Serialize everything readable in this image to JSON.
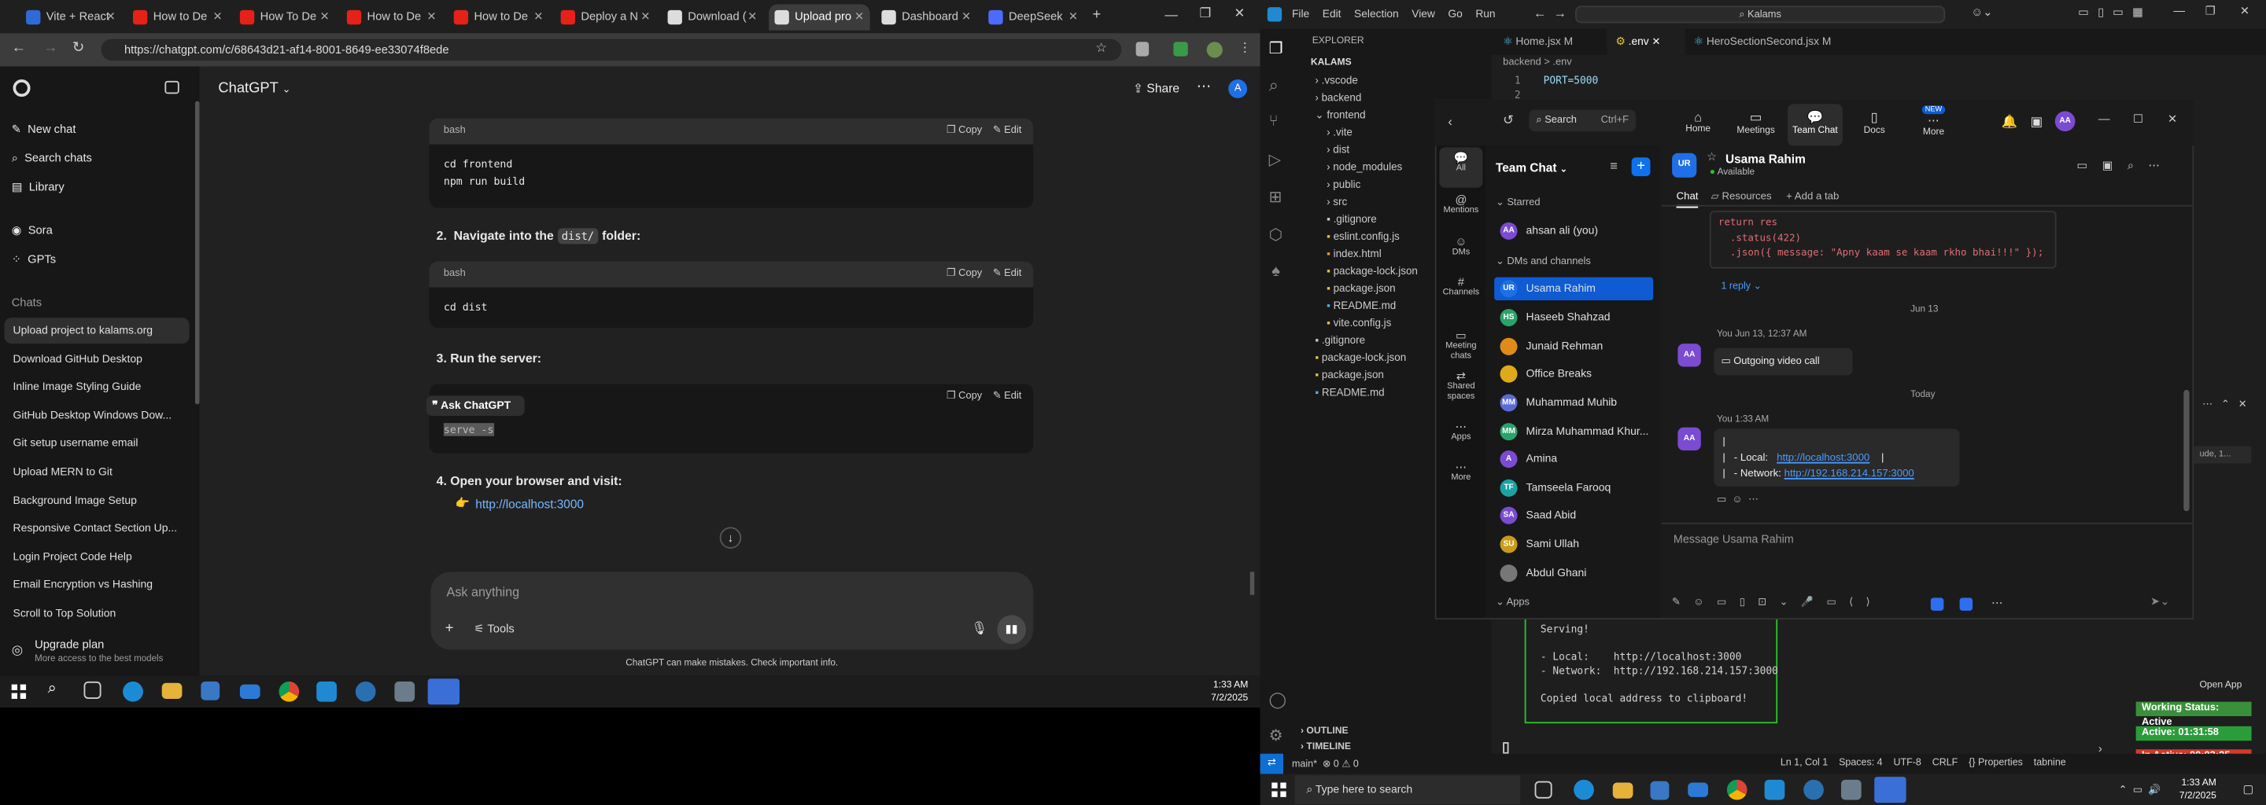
{
  "chrome": {
    "tabs": [
      "Vite + React",
      "How to De",
      "How To De",
      "How to De",
      "How to De",
      "Deploy a N",
      "Download (",
      "Upload pro",
      "Dashboard",
      "DeepSeek"
    ],
    "url": "https://chatgpt.com/c/68643d21-af14-8001-8649-ee33074f8ede",
    "model": "ChatGPT",
    "share": "Share",
    "avatar": "A"
  },
  "gpt_sidebar": {
    "new_chat": "New chat",
    "search_chats": "Search chats",
    "library": "Library",
    "sora": "Sora",
    "gpts": "GPTs",
    "chats_heading": "Chats",
    "chats": [
      "Upload project to kalams.org",
      "Download GitHub Desktop",
      "Inline Image Styling Guide",
      "GitHub Desktop Windows Dow...",
      "Git setup username email",
      "Upload MERN to Git",
      "Background Image Setup",
      "Responsive Contact Section Up...",
      "Login Project Code Help",
      "Email Encryption vs Hashing",
      "Scroll to Top Solution"
    ],
    "upgrade_title": "Upgrade plan",
    "upgrade_sub": "More access to the best models"
  },
  "conversation": {
    "lang": "bash",
    "copy": "Copy",
    "edit": "Edit",
    "code1": "cd frontend\nnpm run build",
    "step2_num": "2.",
    "step2_a": "Navigate into the",
    "step2_code": "dist/",
    "step2_b": "folder:",
    "code2": "cd dist",
    "step3": "3.  Run the server:",
    "ask_chatgpt": "Ask ChatGPT",
    "code3": "serve -s",
    "step4": "4.  Open your browser and visit:",
    "link": "http://localhost:3000",
    "composer_placeholder": "Ask anything",
    "tools": "Tools",
    "disclaimer": "ChatGPT can make mistakes. Check important info."
  },
  "taskbar_left": {
    "time": "1:33 AM",
    "date": "7/2/2025"
  },
  "vscode": {
    "menu": [
      "File",
      "Edit",
      "Selection",
      "View",
      "Go",
      "Run"
    ],
    "search": "Kalams",
    "explorer_title": "EXPLORER",
    "root": "KALAMS",
    "tree": [
      ".vscode",
      "backend",
      "frontend",
      ".vite",
      "dist",
      "node_modules",
      "public",
      "src",
      ".gitignore",
      "eslint.config.js",
      "index.html",
      "package-lock.json",
      "package.json",
      "README.md",
      "vite.config.js",
      ".gitignore",
      "package-lock.json",
      "package.json",
      "README.md"
    ],
    "tabs": [
      "Home.jsx  M",
      ".env",
      "HeroSectionSecond.jsx  M"
    ],
    "breadcrumb": "backend > .env",
    "line1_no": "1",
    "line1": "PORT=5000",
    "line2_no": "2",
    "terminal": "Serving!\n\n- Local:    http://localhost:3000\n- Network:  http://192.168.214.157:3000\n\nCopied local address to clipboard!",
    "outline": "OUTLINE",
    "timeline": "TIMELINE",
    "status_left": "main*  ⊗ 0 ⚠ 0",
    "status_right": "Ln 1, Col 1    Spaces: 4    UTF-8    CRLF    {} Properties    tabnine",
    "open_app": "Open App",
    "working_status": "Working Status: Active",
    "active": "Active: 01:31:58",
    "in_active": "In Active: 00:03:25"
  },
  "taskbar_right": {
    "search": "Type here to search",
    "time": "1:33 AM",
    "date": "7/2/2025"
  },
  "zoom": {
    "search": "Search",
    "shortcut": "Ctrl+F",
    "top_tabs": [
      "Home",
      "Meetings",
      "Team Chat",
      "Docs",
      "More"
    ],
    "new_badge": "NEW",
    "avatar": "AA",
    "nav": [
      "All",
      "Mentions",
      "DMs",
      "Channels",
      "Meeting chats",
      "Shared spaces",
      "Apps",
      "More"
    ],
    "list_title": "Team Chat",
    "starred": "Starred",
    "dms_heading": "DMs and channels",
    "apps_heading": "Apps",
    "contacts": [
      {
        "name": "ahsan ali (you)",
        "init": "AA",
        "color": "#7b4bd1"
      },
      {
        "name": "Usama Rahim",
        "init": "UR",
        "color": "#1f6fe6"
      },
      {
        "name": "Haseeb Shahzad",
        "init": "HS",
        "color": "#2aa36b"
      },
      {
        "name": "Junaid Rehman",
        "init": "",
        "color": "#e08a1a"
      },
      {
        "name": "Office Breaks",
        "init": "",
        "color": "#e0a91a"
      },
      {
        "name": "Muhammad Muhib",
        "init": "MM",
        "color": "#5b6bd6"
      },
      {
        "name": "Mirza Muhammad Khur...",
        "init": "MM",
        "color": "#2aa36b"
      },
      {
        "name": "Amina",
        "init": "A",
        "color": "#7b4bd1"
      },
      {
        "name": "Tamseela Farooq",
        "init": "TF",
        "color": "#1aa3a3"
      },
      {
        "name": "Saad Abid",
        "init": "SA",
        "color": "#7b4bd1"
      },
      {
        "name": "Sami Ullah",
        "init": "SU",
        "color": "#c99b1a"
      },
      {
        "name": "Abdul Ghani",
        "init": "",
        "color": "#777777"
      }
    ],
    "chat_name": "Usama Rahim",
    "chat_init": "UR",
    "chat_status": "Available",
    "chat_tab": "Chat",
    "resources_tab": "Resources",
    "add_tab": "+ Add a tab",
    "code_msg": "return res\n  .status(422)\n  .json({ message: \"Apny kaam se kaam rkho bhai!!!\" });",
    "reply": "1 reply",
    "date_divider": "Jun 13",
    "msg1_meta": "You Jun 13, 12:37 AM",
    "msg1": "Outgoing video call",
    "today": "Today",
    "msg2_meta": "You 1:33 AM",
    "msg2_local_label": "- Local:",
    "msg2_local": "http://localhost:3000",
    "msg2_net_label": "- Network:",
    "msg2_net": "http://192.168.214.157:3000",
    "composer": "Message Usama Rahim"
  }
}
